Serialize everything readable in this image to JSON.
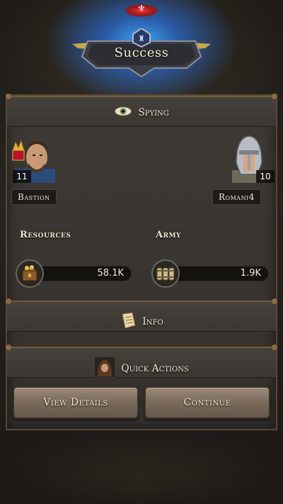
{
  "header": {
    "top_icon": "fleur-de-lis-icon",
    "title": "Success"
  },
  "spying_section": {
    "title": "Spying",
    "icon": "eye-icon"
  },
  "attacker": {
    "name": "Bastion",
    "level": "11",
    "avatar": "king-portrait"
  },
  "target": {
    "name": "Romani4",
    "level": "10",
    "avatar": "knight-helmet-portrait"
  },
  "stats": {
    "resources_label": "Resources",
    "resources_value": "58.1K",
    "resources_icon": "treasure-chest-icon",
    "army_label": "Army",
    "army_value": "1.9K",
    "army_icon": "barrels-icon"
  },
  "info_section": {
    "title": "Info",
    "icon": "scroll-icon"
  },
  "quick_actions_section": {
    "title": "Quick Actions",
    "icon": "hooded-figure-icon"
  },
  "buttons": {
    "view_details": "View Details",
    "continue": "Continue"
  },
  "colors": {
    "panel": "#3a3733",
    "frame": "#7a5a3e",
    "glow": "#3aaaff",
    "button": "#8a7866"
  }
}
